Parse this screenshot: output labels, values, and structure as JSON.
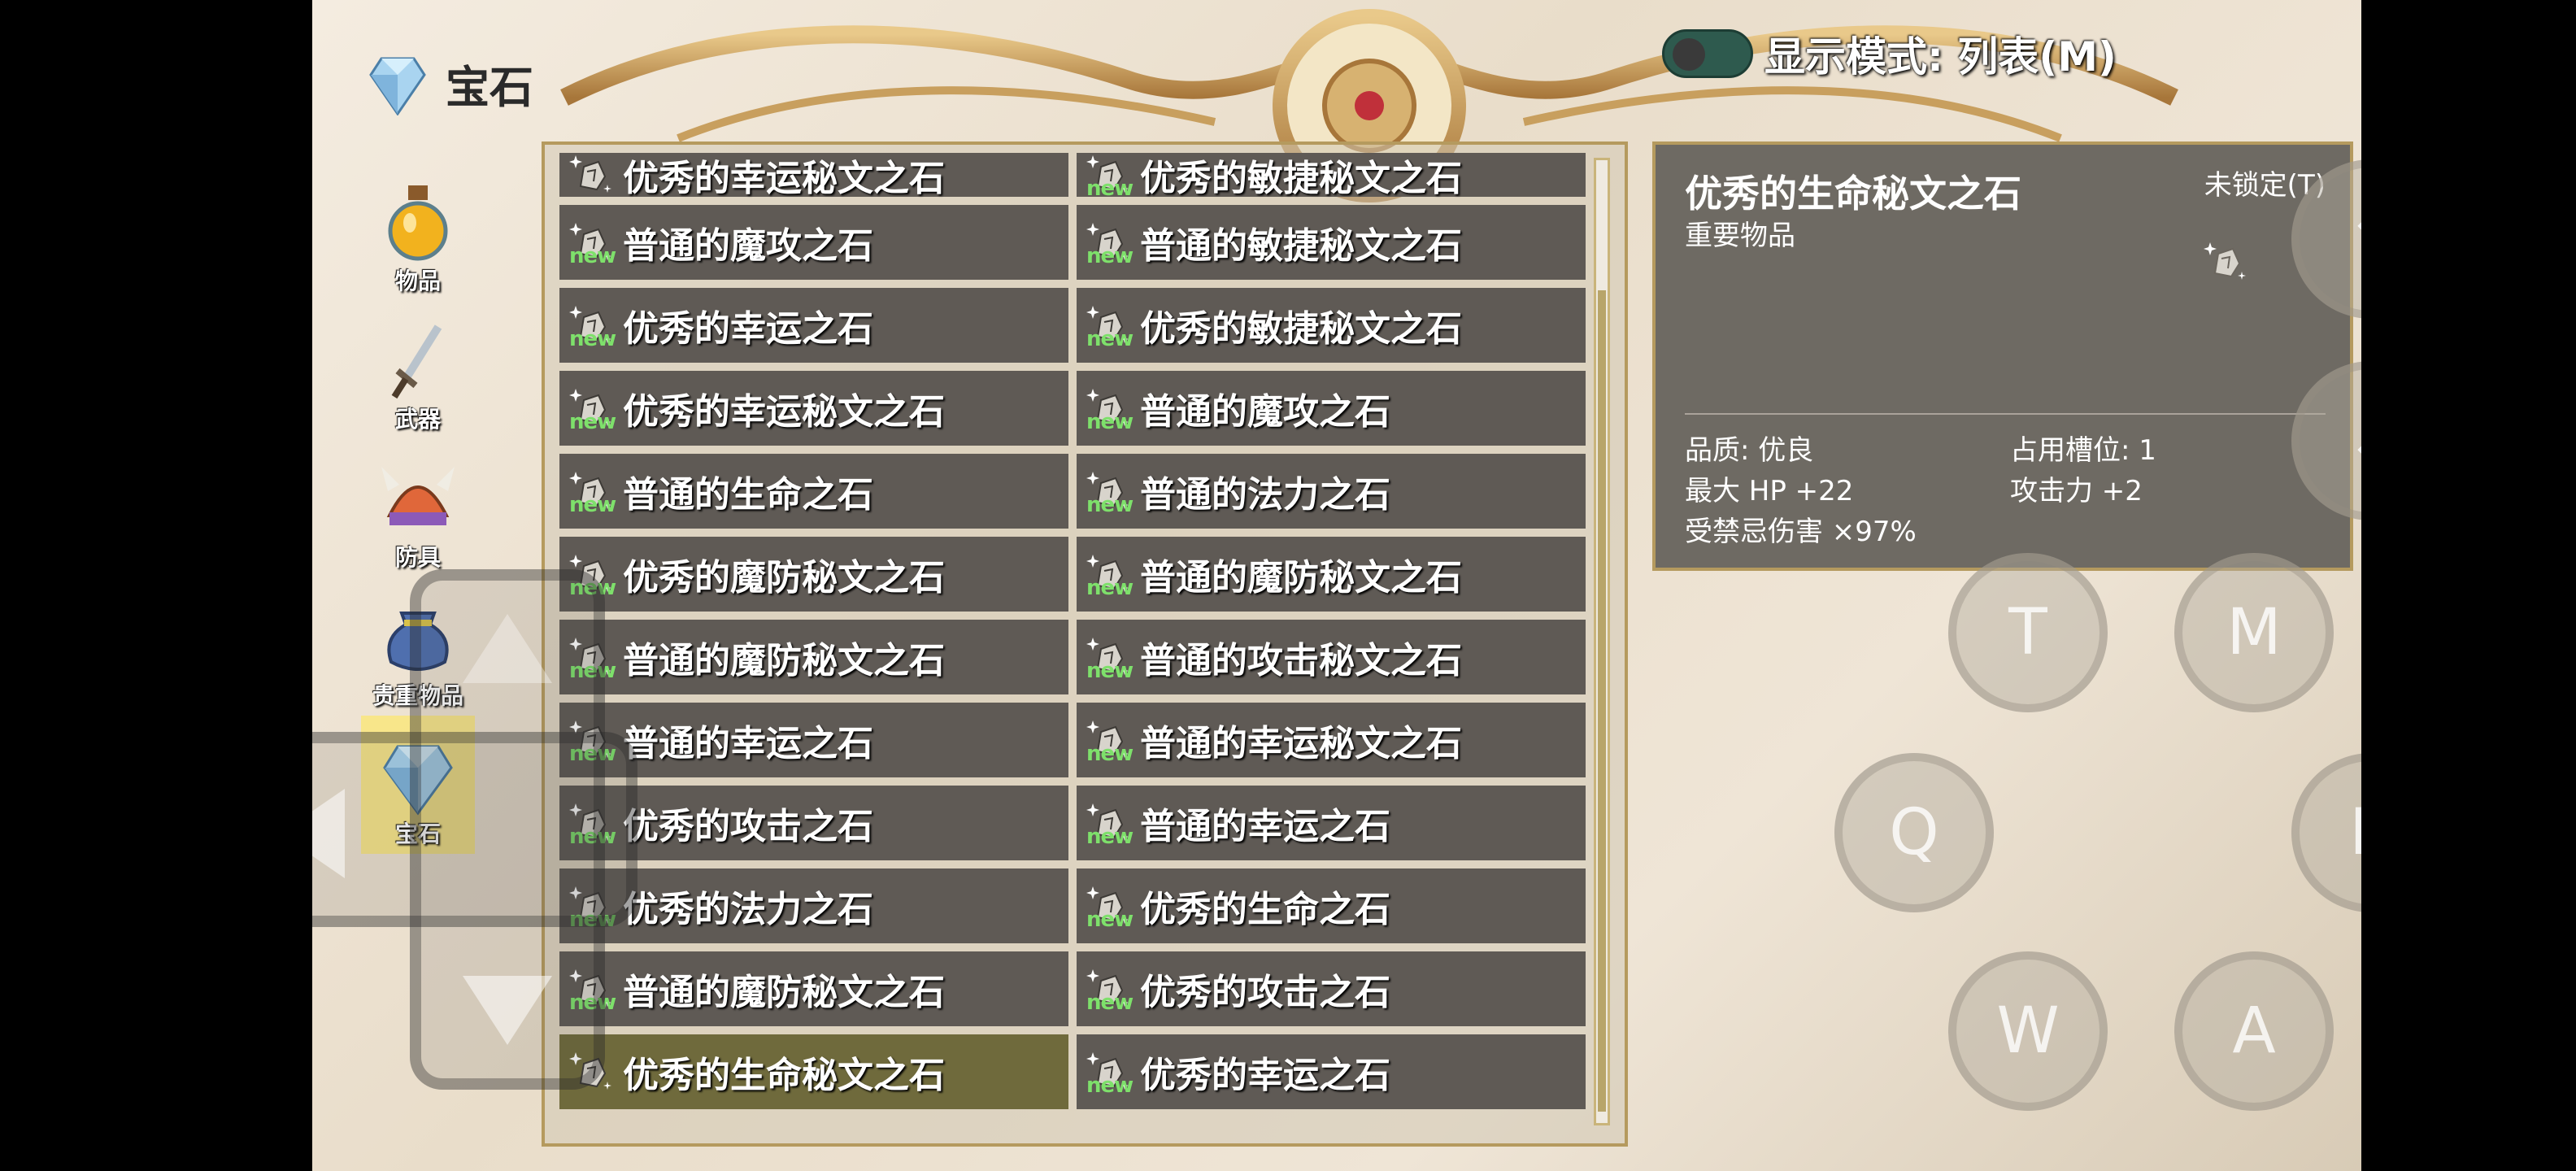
{
  "header": {
    "title": "宝石"
  },
  "mode_toggle": {
    "label": "显示模式: 列表(M)"
  },
  "categories": [
    {
      "label": "物品",
      "icon": "potion-icon"
    },
    {
      "label": "武器",
      "icon": "sword-icon"
    },
    {
      "label": "防具",
      "icon": "helmet-icon"
    },
    {
      "label": "贵重物品",
      "icon": "pouch-icon"
    },
    {
      "label": "宝石",
      "icon": "gem-icon",
      "active": true
    }
  ],
  "items": [
    {
      "name": "优秀的幸运秘文之石",
      "new": false
    },
    {
      "name": "优秀的敏捷秘文之石",
      "new": true
    },
    {
      "name": "普通的魔攻之石",
      "new": true
    },
    {
      "name": "普通的敏捷秘文之石",
      "new": true
    },
    {
      "name": "优秀的幸运之石",
      "new": true
    },
    {
      "name": "优秀的敏捷秘文之石",
      "new": true
    },
    {
      "name": "优秀的幸运秘文之石",
      "new": true
    },
    {
      "name": "普通的魔攻之石",
      "new": true
    },
    {
      "name": "普通的生命之石",
      "new": true
    },
    {
      "name": "普通的法力之石",
      "new": true
    },
    {
      "name": "优秀的魔防秘文之石",
      "new": true
    },
    {
      "name": "普通的魔防秘文之石",
      "new": true
    },
    {
      "name": "普通的魔防秘文之石",
      "new": true
    },
    {
      "name": "普通的攻击秘文之石",
      "new": true
    },
    {
      "name": "普通的幸运之石",
      "new": true
    },
    {
      "name": "普通的幸运秘文之石",
      "new": true
    },
    {
      "name": "优秀的攻击之石",
      "new": true
    },
    {
      "name": "普通的幸运之石",
      "new": true
    },
    {
      "name": "优秀的法力之石",
      "new": true
    },
    {
      "name": "优秀的生命之石",
      "new": true
    },
    {
      "name": "普通的魔防秘文之石",
      "new": true
    },
    {
      "name": "优秀的攻击之石",
      "new": true
    },
    {
      "name": "优秀的生命秘文之石",
      "new": false,
      "selected": true
    },
    {
      "name": "优秀的幸运之石",
      "new": true
    }
  ],
  "new_badge": "new",
  "detail": {
    "name": "优秀的生命秘文之石",
    "lock": "未锁定(T)",
    "category": "重要物品",
    "quality": "品质: 优良",
    "slots": "占用槽位: 1",
    "max_hp": "最大 HP +22",
    "attack": "攻击力 +2",
    "taboo": "受禁忌伤害 ×97%"
  },
  "controls": {
    "up": "↑",
    "down": "↓",
    "t": "T",
    "m": "M",
    "q": "Q",
    "b": "B",
    "w": "W",
    "a": "A"
  },
  "colors": {
    "cell_bg": "#5f5a55",
    "cell_selected": "#6f6a3c",
    "new_badge": "#7ee06b",
    "toggle_track": "#2e5a4e",
    "active_category": "#ffe85a"
  }
}
